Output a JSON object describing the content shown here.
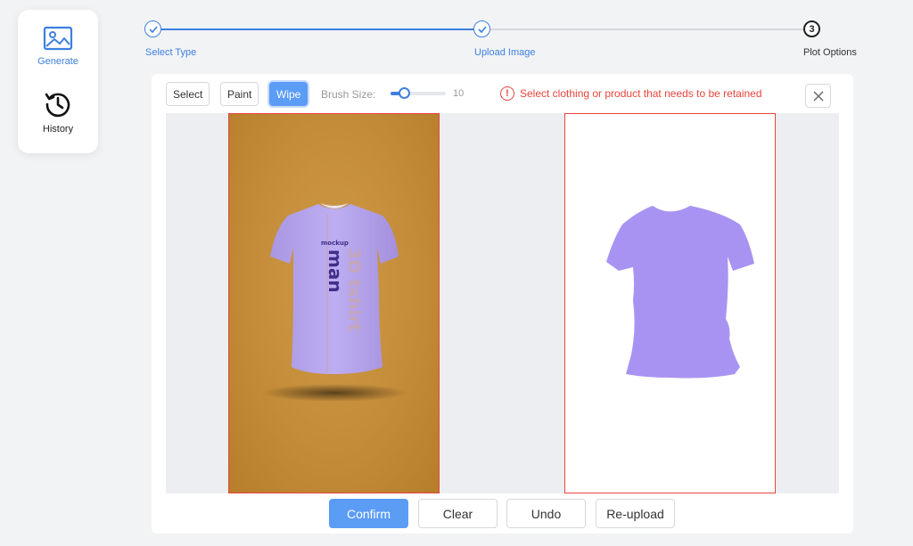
{
  "sidebar": {
    "items": [
      {
        "label": "Generate",
        "icon": "image-icon",
        "active": true
      },
      {
        "label": "History",
        "icon": "history-icon",
        "active": false
      }
    ]
  },
  "stepper": {
    "steps": [
      {
        "label": "Select Type",
        "status": "done"
      },
      {
        "label": "Upload Image",
        "status": "done"
      },
      {
        "label": "Plot Options",
        "status": "current",
        "number": "3"
      }
    ]
  },
  "toolbar": {
    "select_label": "Select",
    "paint_label": "Paint",
    "wipe_label": "Wipe",
    "active_tool": "Wipe",
    "brush_size_label": "Brush Size:",
    "brush_size_value": "10",
    "brush_size_fraction": 0.25,
    "hint_icon": "!",
    "hint_text": "Select clothing or product that needs to be retained",
    "close_icon": "close-icon"
  },
  "canvas": {
    "left_image": {
      "background_color": "#c48c38",
      "shirt_color": "#b9a8ee",
      "print_small": "mockup",
      "print_large": "man",
      "print_side": "3D tshirt"
    },
    "right_mask": {
      "mask_color": "#a993f2"
    }
  },
  "actions": {
    "confirm_label": "Confirm",
    "clear_label": "Clear",
    "undo_label": "Undo",
    "reupload_label": "Re-upload"
  },
  "colors": {
    "accent": "#3d7fe0",
    "accent_light": "#5b9cf5",
    "error": "#e8453c"
  }
}
